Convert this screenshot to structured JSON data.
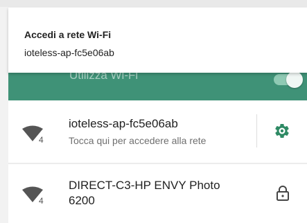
{
  "notification": {
    "title": "Accedi a rete Wi-Fi",
    "network": "ioteless-ap-fc5e06ab"
  },
  "header": {
    "title": "Utilizza Wi-Fi",
    "toggle_on": true
  },
  "networks": [
    {
      "name": "ioteless-ap-fc5e06ab",
      "status": "Tocca qui per accedere alla rete",
      "signal_icon": "wifi-signal-4-icon",
      "action_icon": "gear-icon",
      "badge": "4"
    },
    {
      "name_line1": "DIRECT-C3-HP ENVY Photo",
      "name_line2": "6200",
      "signal_icon": "wifi-signal-4-icon",
      "action_icon": "lock-icon",
      "badge": "4"
    }
  ],
  "colors": {
    "accent": "#3f9277",
    "gear": "#2e8a64",
    "signal": "#555555"
  }
}
